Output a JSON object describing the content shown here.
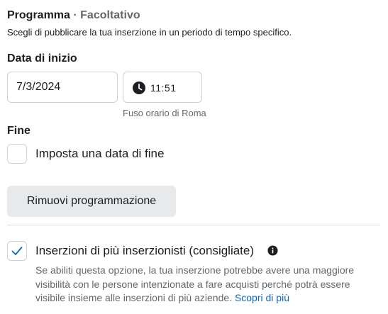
{
  "schedule": {
    "title": "Programma",
    "optional": "· Facoltativo",
    "description": "Scegli di pubblicare la tua inserzione in un periodo di tempo specifico."
  },
  "start": {
    "label": "Data di inizio",
    "date_value": "7/3/2024",
    "time_value": "11:51",
    "timezone": "Fuso orario di Roma",
    "time_icon": "clock-icon"
  },
  "end": {
    "label": "Fine",
    "checkbox_label": "Imposta una data di fine",
    "checked": false
  },
  "remove_button": {
    "label": "Rimuovi programmazione"
  },
  "advertisers": {
    "checkbox_label": "Inserzioni di più inserzionisti (consigliate)",
    "checked": true,
    "description": "Se abiliti questa opzione, la tua inserzione potrebbe avere una maggiore visibilità con le persone intenzionate a fare acquisti perché potrà essere visibile insieme alle inserzioni di più aziende.",
    "learn_more": "Scopri di più",
    "info_icon": "info-icon",
    "check_icon": "checkmark-icon"
  },
  "colors": {
    "link": "#0a66c2",
    "muted_text": "#65676b",
    "border": "#ced0d4",
    "button_bg": "#e8e9eb"
  }
}
